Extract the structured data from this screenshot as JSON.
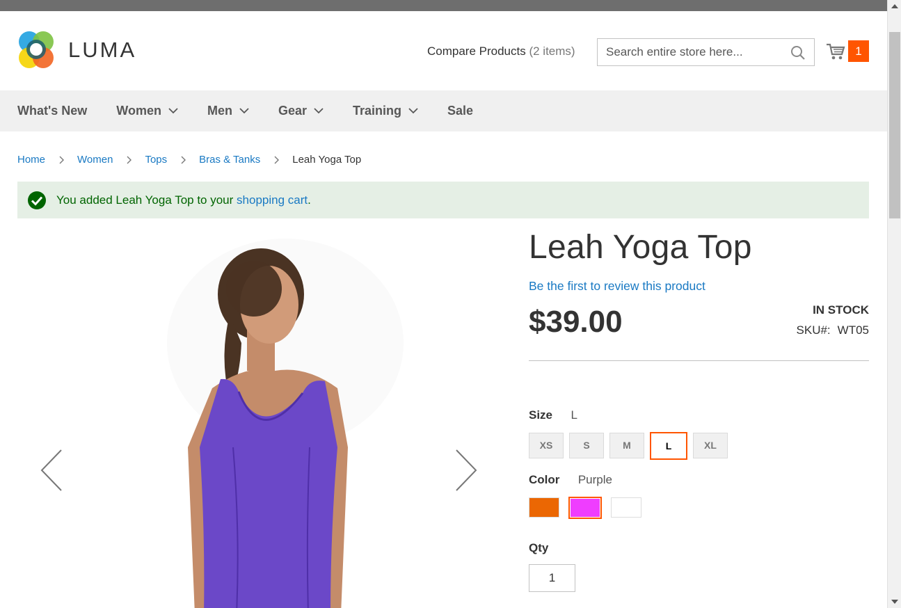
{
  "header": {
    "logo_text": "LUMA",
    "compare_label": "Compare Products",
    "compare_count": "(2 items)",
    "search_placeholder": "Search entire store here...",
    "cart_count": "1"
  },
  "nav": {
    "items": [
      {
        "label": "What's New",
        "has_dropdown": false
      },
      {
        "label": "Women",
        "has_dropdown": true
      },
      {
        "label": "Men",
        "has_dropdown": true
      },
      {
        "label": "Gear",
        "has_dropdown": true
      },
      {
        "label": "Training",
        "has_dropdown": true
      },
      {
        "label": "Sale",
        "has_dropdown": false
      }
    ]
  },
  "breadcrumb": {
    "links": [
      "Home",
      "Women",
      "Tops",
      "Bras & Tanks"
    ],
    "current": "Leah Yoga Top"
  },
  "message": {
    "prefix": "You added Leah Yoga Top to your",
    "link": "shopping cart",
    "suffix": "."
  },
  "product": {
    "title": "Leah Yoga Top",
    "review_link": "Be the first to review this product",
    "price": "$39.00",
    "stock": "IN STOCK",
    "sku_label": "SKU#:",
    "sku": "WT05",
    "size_label": "Size",
    "size_selected": "L",
    "sizes": [
      "XS",
      "S",
      "M",
      "L",
      "XL"
    ],
    "color_label": "Color",
    "color_selected": "Purple",
    "colors": [
      {
        "name": "Orange",
        "hex": "#eb6703"
      },
      {
        "name": "Purple",
        "hex": "#ef3dff"
      },
      {
        "name": "White",
        "hex": "#ffffff"
      }
    ],
    "qty_label": "Qty",
    "qty_value": "1"
  },
  "colors": {
    "accent": "#ff5501",
    "link": "#1979c3",
    "success_bg": "#e5efe5",
    "success_text": "#006400",
    "nav_bg": "#f0f0f0",
    "tank_purple": "#6b48c8"
  }
}
